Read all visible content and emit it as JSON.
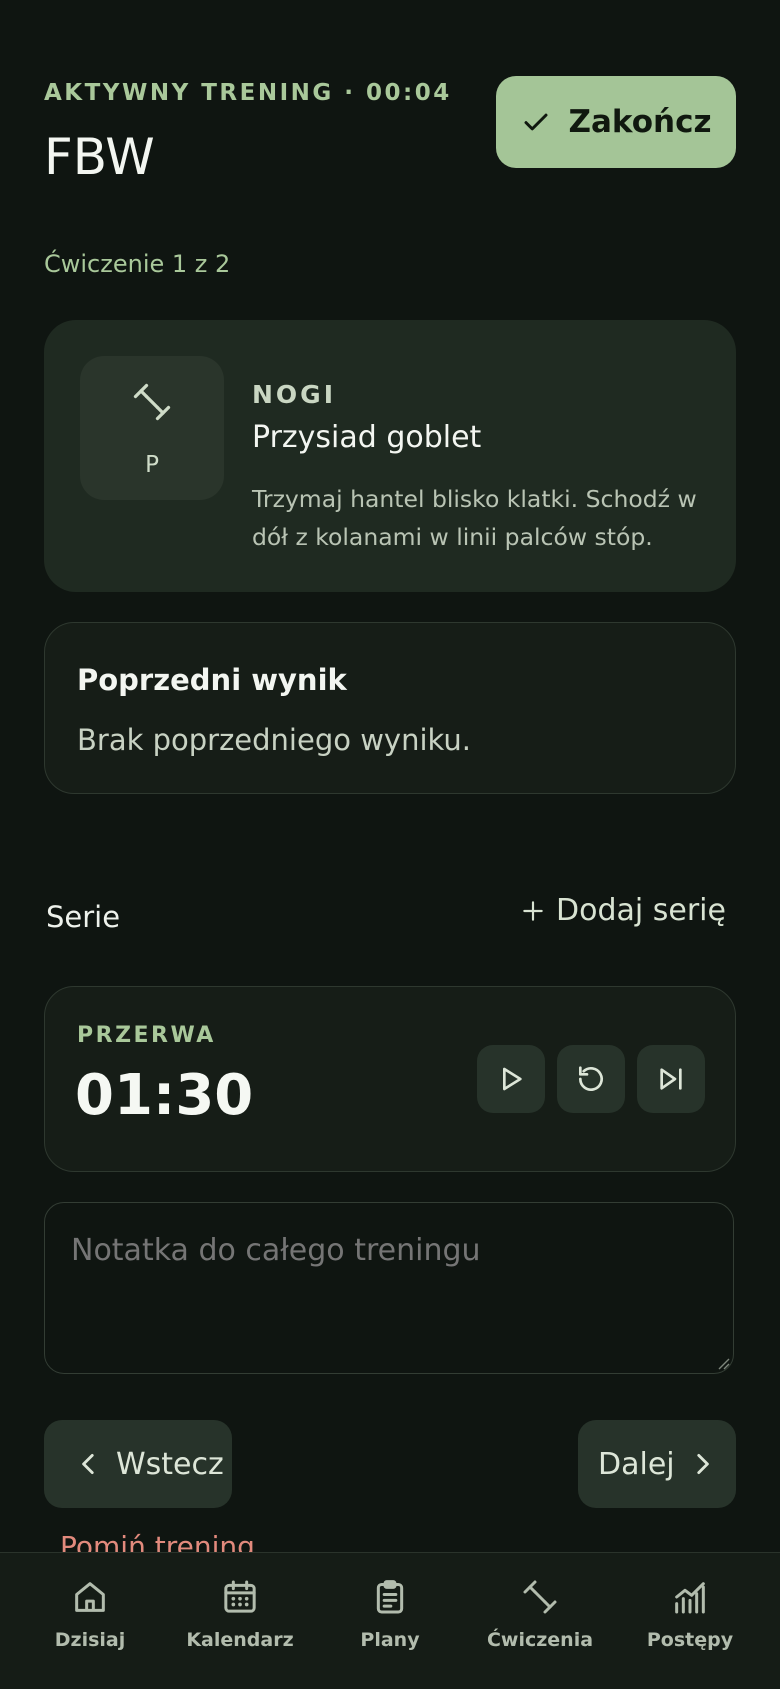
{
  "header": {
    "eyebrow": "AKTYWNY TRENING · 00:04",
    "title": "FBW",
    "finish_label": "Zakończ"
  },
  "progress": {
    "counter": "Ćwiczenie 1 z 2"
  },
  "exercise": {
    "category": "NOGI",
    "name": "Przysiad goblet",
    "description": "Trzymaj hantel blisko klatki. Schodź w dół z kolanami w linii palców stóp.",
    "thumb_letter": "P",
    "icon": "dumbbell-icon"
  },
  "previous": {
    "title": "Poprzedni wynik",
    "text": "Brak poprzedniego wyniku."
  },
  "sets": {
    "label": "Serie",
    "add_label": "Dodaj serię"
  },
  "timer": {
    "label": "PRZERWA",
    "value": "01:30",
    "controls": [
      "play-icon",
      "reset-icon",
      "skip-icon"
    ]
  },
  "note": {
    "placeholder": "Notatka do całego treningu",
    "value": ""
  },
  "navigation": {
    "back_label": "Wstecz",
    "next_label": "Dalej",
    "skip_label": "Pomiń trening"
  },
  "bottom_nav": {
    "items": [
      {
        "label": "Dzisiaj",
        "icon": "home-icon"
      },
      {
        "label": "Kalendarz",
        "icon": "calendar-icon"
      },
      {
        "label": "Plany",
        "icon": "clipboard-icon"
      },
      {
        "label": "Ćwiczenia",
        "icon": "dumbbell-icon"
      },
      {
        "label": "Postępy",
        "icon": "chart-icon"
      }
    ]
  },
  "colors": {
    "background": "#0f1511",
    "accent": "#a4c597",
    "card": "#1f2a21",
    "danger": "#e28a7d"
  }
}
